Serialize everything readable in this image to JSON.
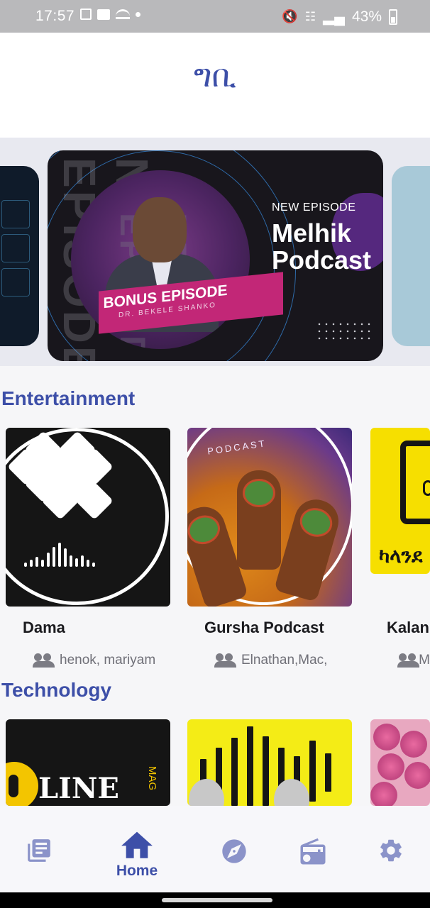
{
  "status_bar": {
    "time": "17:57",
    "battery": "43%",
    "left_icons": [
      "gallery-icon",
      "message-icon",
      "weather-icon",
      "dot-icon"
    ],
    "right_icons": [
      "mute-icon",
      "wifi-icon",
      "signal-icon",
      "battery-icon"
    ]
  },
  "header": {
    "title": "ግቢ"
  },
  "carousel": {
    "featured": {
      "side_text": "NEW EPISODE",
      "banner_title": "BONUS EPISODE",
      "banner_guest": "DR. BEKELE SHANKO",
      "episode_label": "NEW EPISODE",
      "podcast_name_line1": "Melhik",
      "podcast_name_line2": "Podcast"
    }
  },
  "sections": [
    {
      "title": "Entertainment",
      "items": [
        {
          "name": "Dama",
          "authors": "henok, mariyam"
        },
        {
          "name": "Gursha Podcast",
          "authors": "Elnathan,Mac,",
          "art_text": "PODCAST"
        },
        {
          "name": "Kalan",
          "authors": "M",
          "art_text": "ካላንደ"
        }
      ]
    },
    {
      "title": "Technology",
      "items": [
        {
          "art_text": "LINE",
          "art_sub": "MAG"
        },
        {},
        {}
      ]
    }
  ],
  "bottom_nav": {
    "items": [
      {
        "icon": "library-icon",
        "label": ""
      },
      {
        "icon": "home-icon",
        "label": "Home"
      },
      {
        "icon": "explore-icon",
        "label": ""
      },
      {
        "icon": "radio-icon",
        "label": ""
      },
      {
        "icon": "settings-icon",
        "label": ""
      }
    ],
    "active_index": 1,
    "accent_color": "#3d4fa8",
    "inactive_color": "#8b93c9"
  }
}
